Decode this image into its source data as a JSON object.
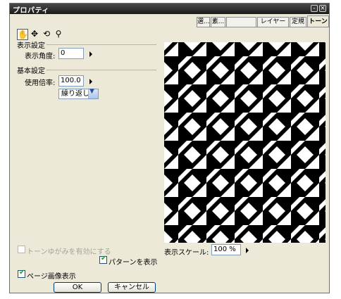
{
  "window": {
    "title": "プロパティ",
    "title_buttons": [
      "-",
      "×"
    ]
  },
  "tabs": [
    {
      "label": "選..."
    },
    {
      "label": "素..."
    },
    {
      "label": ""
    },
    {
      "label": "レイヤー"
    },
    {
      "label": "定規"
    },
    {
      "label": "トーン"
    }
  ],
  "tools": [
    "hand-icon",
    "move-icon",
    "rotate-icon",
    "pin-icon"
  ],
  "display_settings": {
    "heading": "表示設定",
    "angle_label": "表示角度:",
    "angle_value": "0"
  },
  "basic_settings": {
    "heading": "基本設定",
    "scale_label": "使用倍率:",
    "scale_value": "100.0",
    "mode_value": "繰り返し"
  },
  "preview": {
    "scale_label": "表示スケール:",
    "scale_value": "100 %"
  },
  "options": {
    "tone_distortion": {
      "label": "トーンゆがみを有効にする",
      "checked": false,
      "enabled": false
    },
    "show_pattern": {
      "label": "パターンを表示",
      "checked": true,
      "enabled": true
    },
    "show_page_image": {
      "label": "ページ画像表示",
      "checked": true,
      "enabled": true
    }
  },
  "buttons": {
    "ok": "OK",
    "cancel": "キャンセル"
  },
  "colors": {
    "titlebar": "#2a2a2a",
    "dialog_bg": "#ece9d8",
    "field_border": "#7f9db9",
    "pattern": "#000000"
  }
}
